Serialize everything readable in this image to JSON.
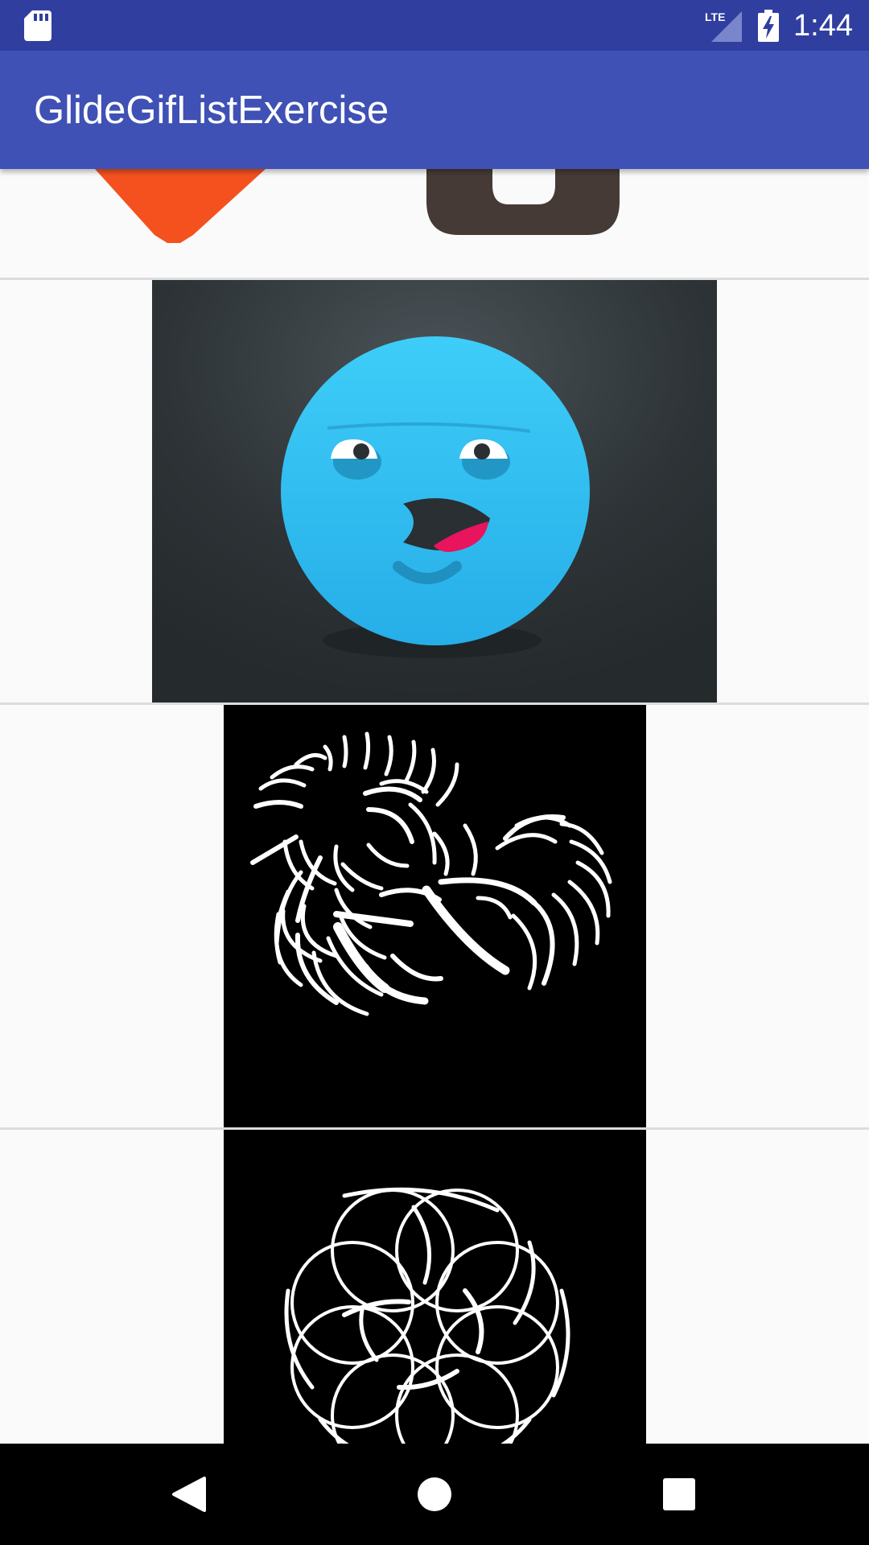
{
  "status_bar": {
    "time": "1:44",
    "network": "LTE",
    "icons": [
      "sd-card-icon",
      "lte-signal-icon",
      "battery-charging-icon"
    ]
  },
  "app_bar": {
    "title": "GlideGifListExercise"
  },
  "list": {
    "items": [
      {
        "content": "gif-logo-partial"
      },
      {
        "content": "gif-blue-face"
      },
      {
        "content": "gif-white-arcs-spiral"
      },
      {
        "content": "gif-white-arcs-flower"
      }
    ]
  },
  "nav_bar": {
    "buttons": [
      "back-icon",
      "home-icon",
      "recents-icon"
    ]
  },
  "colors": {
    "status_bar": "#303f9f",
    "app_bar": "#3f51b5",
    "list_background": "#fafafa",
    "divider": "#dcdcdc",
    "nav_bar": "#000000"
  }
}
